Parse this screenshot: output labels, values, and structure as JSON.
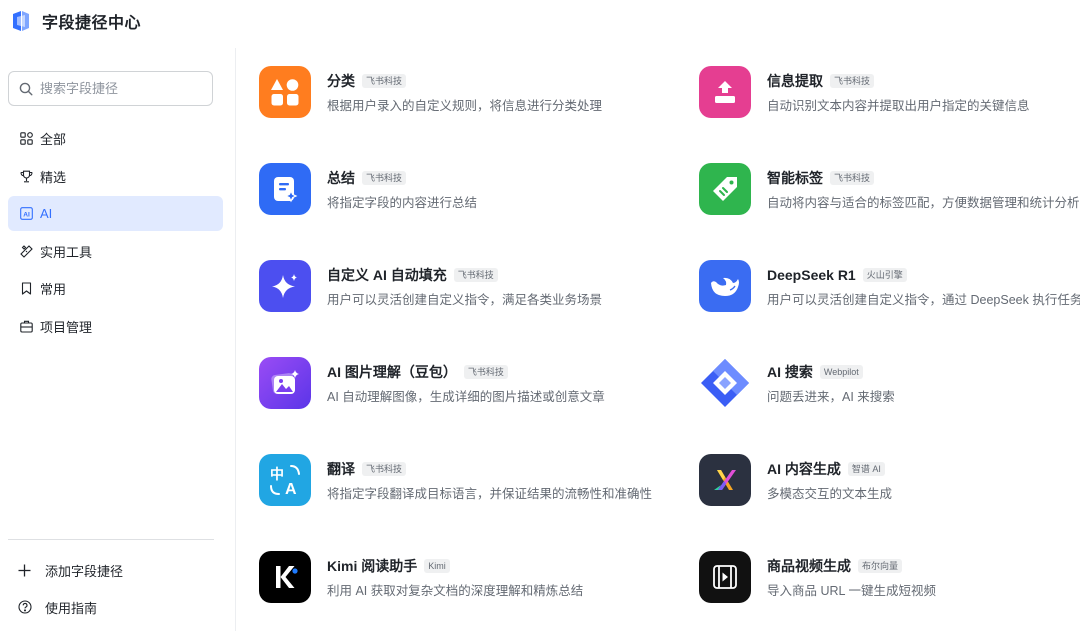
{
  "header": {
    "title": "字段捷径中心",
    "logo_icon": "shortcut-logo-icon"
  },
  "sidebar": {
    "search": {
      "placeholder": "搜索字段捷径",
      "value": ""
    },
    "items": [
      {
        "label": "全部",
        "icon": "grid-icon"
      },
      {
        "label": "精选",
        "icon": "trophy-icon"
      },
      {
        "label": "AI",
        "icon": "ai-icon",
        "active": true
      },
      {
        "label": "实用工具",
        "icon": "tools-icon"
      },
      {
        "label": "常用",
        "icon": "bookmark-icon"
      },
      {
        "label": "项目管理",
        "icon": "briefcase-icon"
      }
    ],
    "add_label": "添加字段捷径",
    "guide_label": "使用指南"
  },
  "cards": [
    {
      "title": "分类",
      "badge": "飞书科技",
      "desc": "根据用户录入的自定义规则，将信息进行分类处理",
      "icon": "shapes-icon",
      "color": "#ff7d1f"
    },
    {
      "title": "信息提取",
      "badge": "飞书科技",
      "desc": "自动识别文本内容并提取出用户指定的关键信息",
      "icon": "extract-icon",
      "color": "#e53e91"
    },
    {
      "title": "总结",
      "badge": "飞书科技",
      "desc": "将指定字段的内容进行总结",
      "icon": "summary-doc-icon",
      "color": "#2f6bf5"
    },
    {
      "title": "智能标签",
      "badge": "飞书科技",
      "desc": "自动将内容与适合的标签匹配，方便数据管理和统计分析",
      "icon": "tag-icon",
      "color": "#2fb54e"
    },
    {
      "title": "自定义 AI 自动填充",
      "badge": "飞书科技",
      "desc": "用户可以灵活创建自定义指令，满足各类业务场景",
      "icon": "sparkle-icon",
      "color": "#4c4ff0"
    },
    {
      "title": "DeepSeek R1",
      "badge": "火山引擎",
      "desc": "用户可以灵活创建自定义指令，通过 DeepSeek 执行任务",
      "icon": "whale-icon",
      "color": "#3a6cf2"
    },
    {
      "title": "AI 图片理解（豆包）",
      "badge": "飞书科技",
      "desc": "AI 自动理解图像，生成详细的图片描述或创意文章",
      "icon": "image-sparkle-icon",
      "color": "#7b3ff0"
    },
    {
      "title": "AI 搜索",
      "badge": "Webpilot",
      "desc": "问题丢进来，AI 来搜索",
      "icon": "webpilot-icon",
      "color": "#ffffff"
    },
    {
      "title": "翻译",
      "badge": "飞书科技",
      "desc": "将指定字段翻译成目标语言，并保证结果的流畅性和准确性",
      "icon": "translate-icon",
      "color": "#21a6e3"
    },
    {
      "title": "AI 内容生成",
      "badge": "智谱 AI",
      "desc": "多模态交互的文本生成",
      "icon": "zhipu-x-icon",
      "color": "#2b3140"
    },
    {
      "title": "Kimi 阅读助手",
      "badge": "Kimi",
      "desc": "利用 AI 获取对复杂文档的深度理解和精炼总结",
      "icon": "kimi-icon",
      "color": "#000000"
    },
    {
      "title": "商品视频生成",
      "badge": "布尔向量",
      "desc": "导入商品 URL 一键生成短视频",
      "icon": "video-icon",
      "color": "#111111"
    }
  ]
}
